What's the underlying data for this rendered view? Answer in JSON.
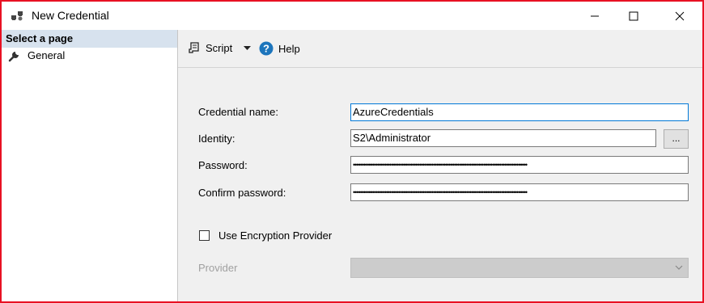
{
  "window": {
    "title": "New Credential"
  },
  "left_pane": {
    "header": "Select a page",
    "items": [
      {
        "label": "General",
        "icon": "wrench-icon"
      }
    ]
  },
  "toolbar": {
    "script_label": "Script",
    "help_label": "Help"
  },
  "form": {
    "credential_name": {
      "label": "Credential name:",
      "value": "AzureCredentials"
    },
    "identity": {
      "label": "Identity:",
      "value": "S2\\Administrator",
      "browse_label": "..."
    },
    "password": {
      "label": "Password:",
      "value": "••••••••••••••••••••••••••••••••••••••••••••••••••••••••••••••••••••••••••••••••••••••••••••••••••••"
    },
    "confirm_password": {
      "label": "Confirm password:",
      "value": "••••••••••••••••••••••••••••••••••••••••••••••••••••••••••••••••••••••••••••••••••••••••••••••••••••"
    },
    "use_encryption_provider": {
      "label": "Use Encryption Provider",
      "checked": false
    },
    "provider": {
      "label": "Provider",
      "value": ""
    }
  },
  "colors": {
    "window_border": "#e81123",
    "selected_header_bg": "#d7e2ee",
    "focus_border": "#0078d7",
    "help_icon": "#1c75bc"
  }
}
